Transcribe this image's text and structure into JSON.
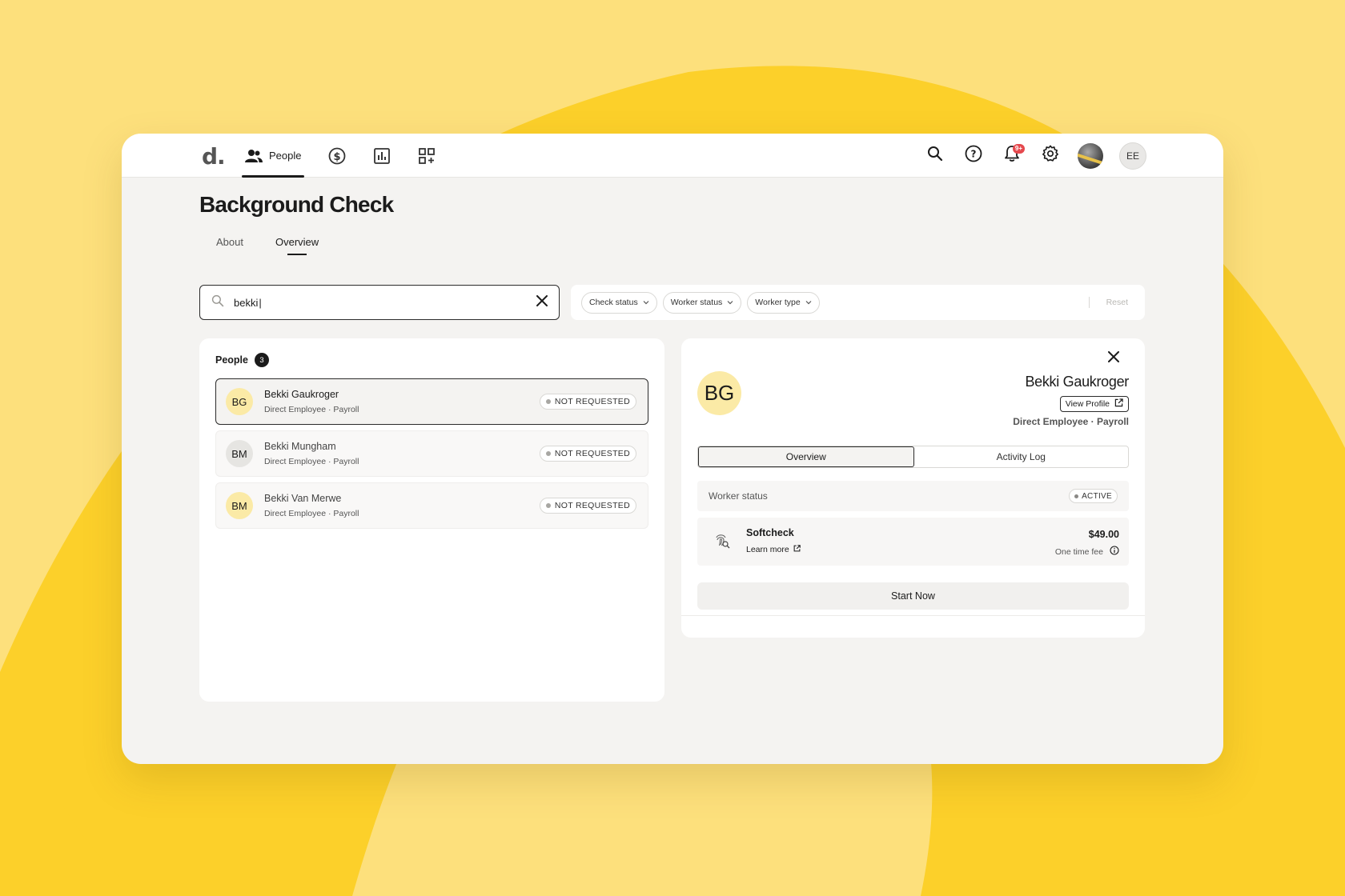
{
  "app": {
    "logo": "d.",
    "nav": [
      {
        "id": "people",
        "label": "People",
        "icon": "people-icon",
        "active": true
      },
      {
        "id": "payroll",
        "label": "",
        "icon": "dollar-circle-icon",
        "active": false
      },
      {
        "id": "reports",
        "label": "",
        "icon": "bar-chart-icon",
        "active": false
      },
      {
        "id": "apps",
        "label": "",
        "icon": "apps-grid-icon",
        "active": false
      }
    ],
    "top_icons": [
      "search-icon",
      "help-icon",
      "bell-icon",
      "gear-icon"
    ],
    "notification_badge": "9+",
    "user_initials": "EE"
  },
  "page": {
    "title": "Background Check",
    "tabs": [
      {
        "label": "About",
        "active": false
      },
      {
        "label": "Overview",
        "active": true
      }
    ]
  },
  "search": {
    "value": "bekki"
  },
  "filters": {
    "chips": [
      {
        "label": "Check status"
      },
      {
        "label": "Worker status"
      },
      {
        "label": "Worker type"
      }
    ],
    "reset_label": "Reset"
  },
  "people": {
    "title": "People",
    "count": "3",
    "rows": [
      {
        "initials": "BG",
        "name": "Bekki Gaukroger",
        "sub": "Direct Employee · Payroll",
        "status": "NOT REQUESTED",
        "selected": true,
        "avatar_color": "yellow"
      },
      {
        "initials": "BM",
        "name": "Bekki Mungham",
        "sub": "Direct Employee · Payroll",
        "status": "NOT REQUESTED",
        "selected": false,
        "avatar_color": "grey"
      },
      {
        "initials": "BM",
        "name": "Bekki Van Merwe",
        "sub": "Direct Employee · Payroll",
        "status": "NOT REQUESTED",
        "selected": false,
        "avatar_color": "yellow"
      }
    ]
  },
  "detail": {
    "initials": "BG",
    "name": "Bekki Gaukroger",
    "view_profile_label": "View Profile",
    "sub": "Direct Employee · Payroll",
    "tabs": [
      {
        "label": "Overview",
        "active": true
      },
      {
        "label": "Activity Log",
        "active": false
      }
    ],
    "worker_status_label": "Worker status",
    "worker_status_value": "ACTIVE",
    "product": {
      "name": "Softcheck",
      "learn_more": "Learn more",
      "price": "$49.00",
      "fee_label": "One time fee"
    },
    "start_label": "Start Now"
  },
  "colors": {
    "background": "#fde07c",
    "accent_yellow": "#fcd02a",
    "avatar_yellow": "#fbeaa6",
    "badge_red": "#e5484d"
  }
}
